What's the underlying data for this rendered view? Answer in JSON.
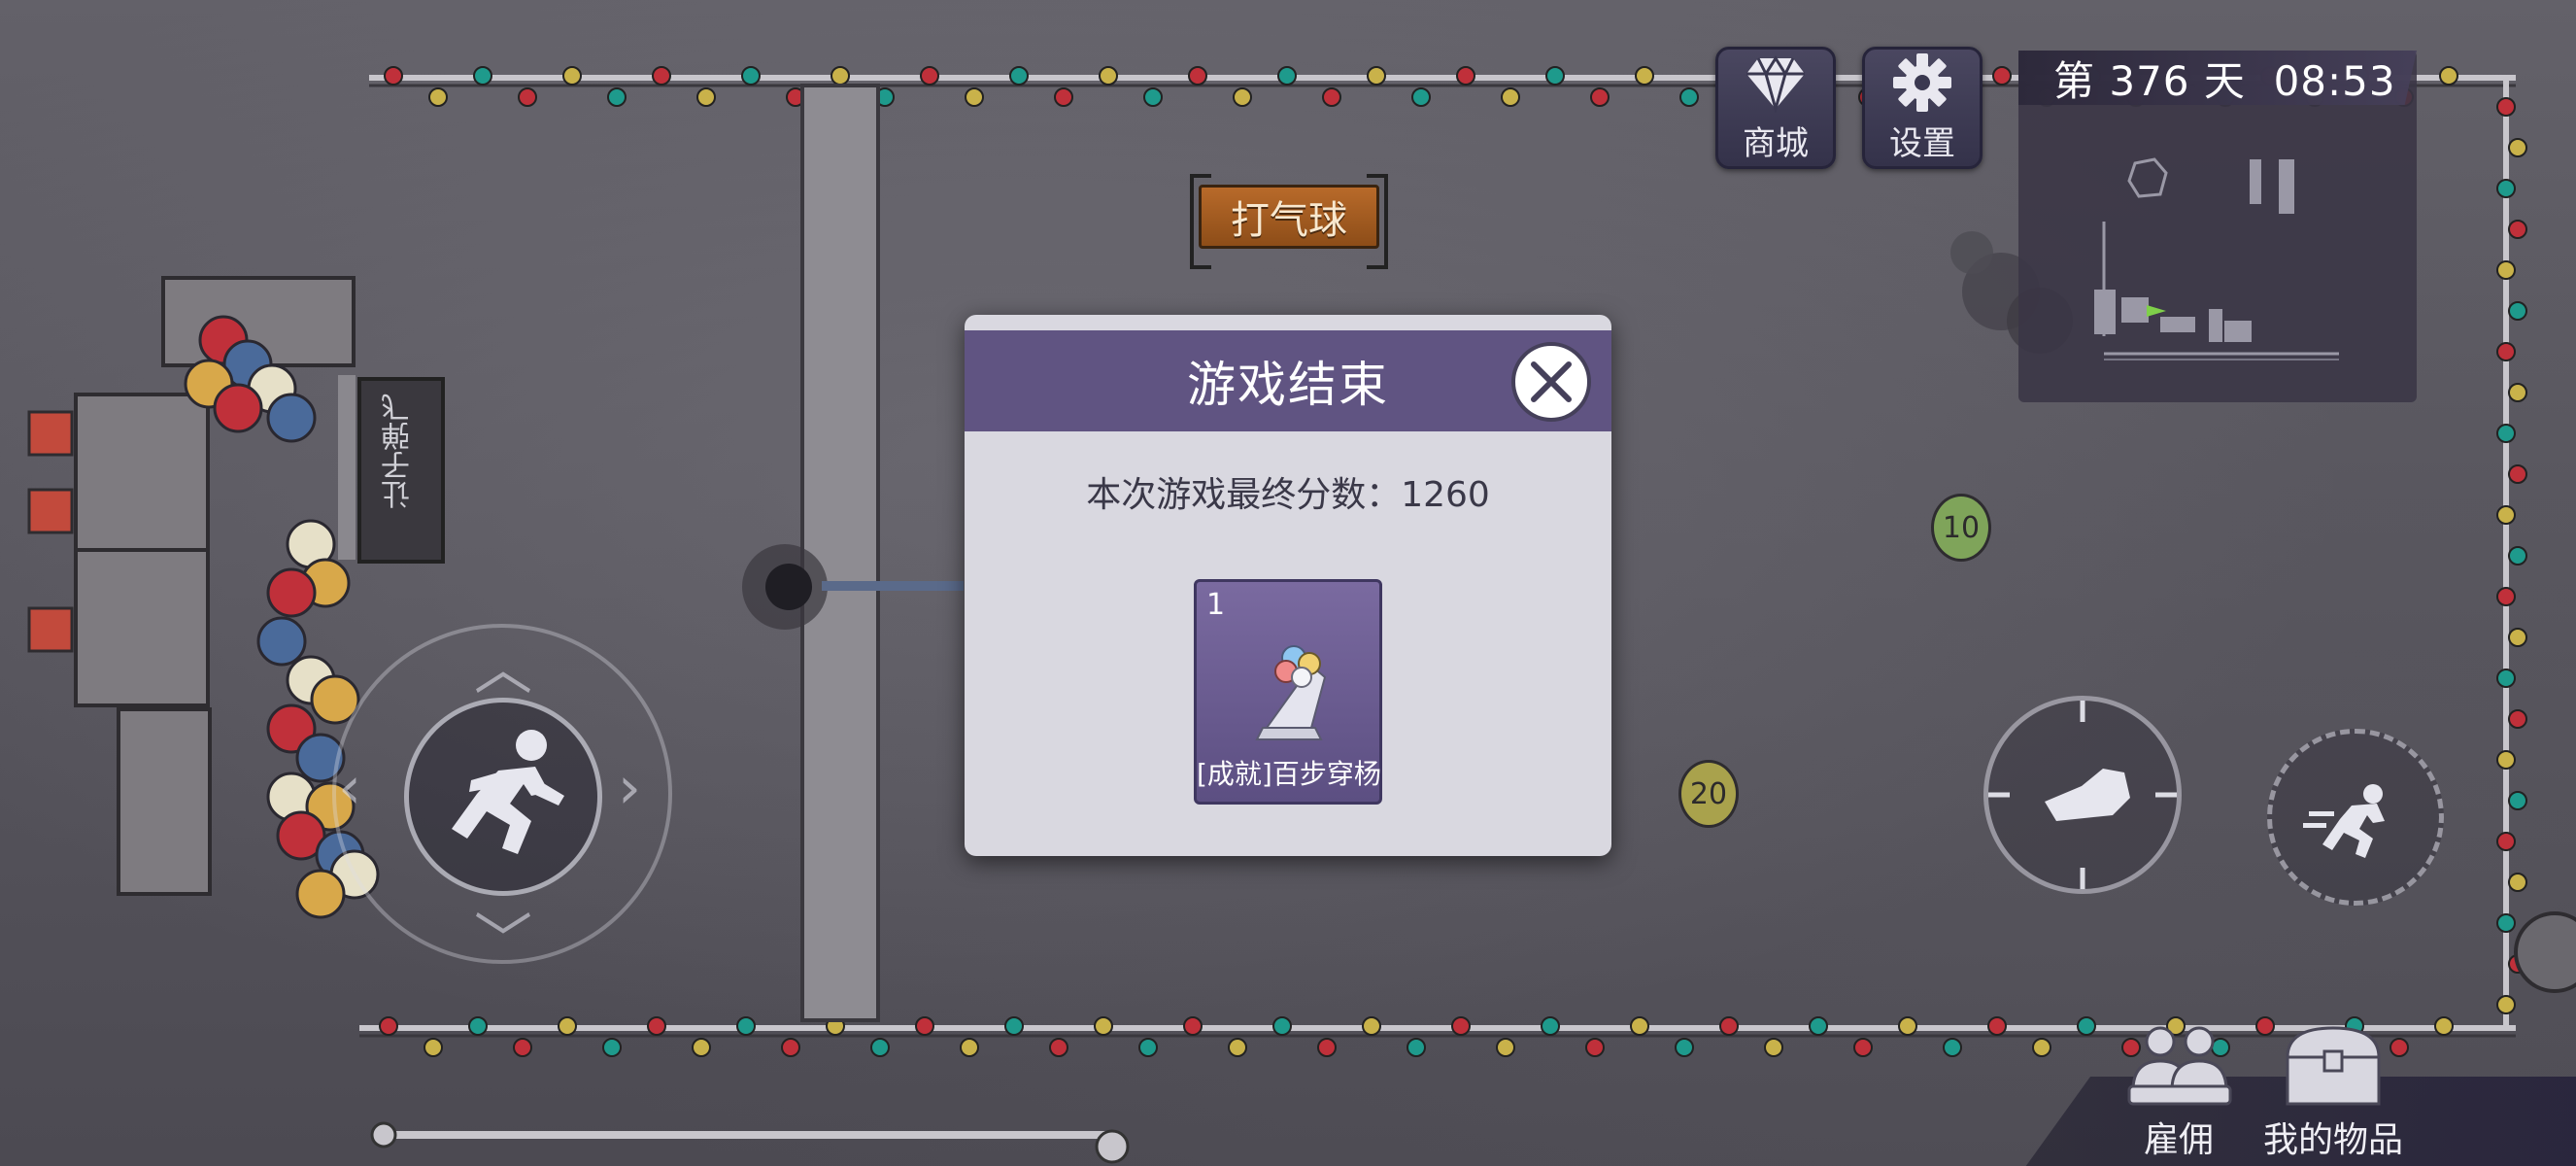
{
  "hud": {
    "shop_label": "商城",
    "settings_label": "设置",
    "day_time": "第 376 天  08:53"
  },
  "scene": {
    "sign_label": "打气球",
    "banner_text": "让子弹飞",
    "balloons": [
      {
        "value": "10",
        "color": "#7fa45a"
      },
      {
        "value": "20",
        "color": "#a9a24c"
      }
    ]
  },
  "dialog": {
    "title": "游戏结束",
    "score_text": "本次游戏最终分数：1260",
    "reward": {
      "count": "1",
      "name": "[成就]百步穿杨",
      "icon": "balloon-trophy-icon"
    }
  },
  "bottom": {
    "hire_label": "雇佣",
    "items_label": "我的物品"
  },
  "colors": {
    "dialog_header": "#605482",
    "dialog_body": "#d9d8e0",
    "reward_card": "#6b5c92"
  }
}
